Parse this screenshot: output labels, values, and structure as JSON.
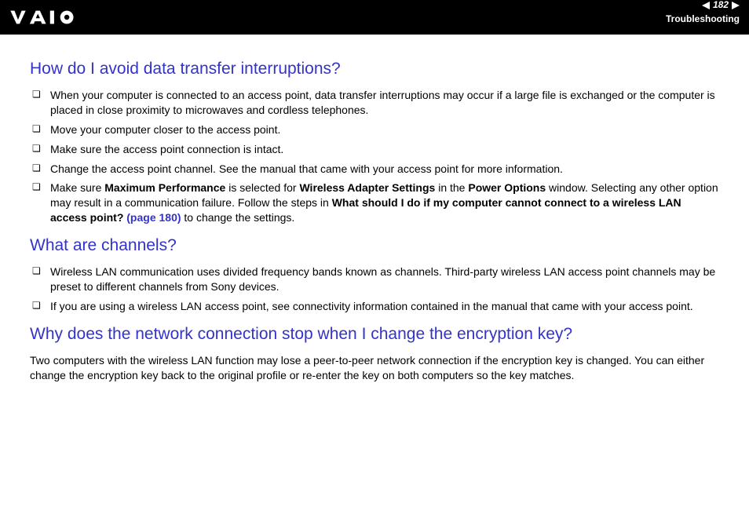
{
  "header": {
    "page_number": "182",
    "section": "Troubleshooting"
  },
  "sections": [
    {
      "heading": "How do I avoid data transfer interruptions?",
      "bullets": [
        {
          "pre": "When your computer is connected to an access point, data transfer interruptions may occur if a large file is exchanged or the computer is placed in close proximity to microwaves and cordless telephones."
        },
        {
          "pre": "Move your computer closer to the access point."
        },
        {
          "pre": "Make sure the access point connection is intact."
        },
        {
          "pre": "Change the access point channel. See the manual that came with your access point for more information."
        },
        {
          "pre": "Make sure ",
          "b1": "Maximum Performance",
          "mid1": " is selected for ",
          "b2": "Wireless Adapter Settings",
          "mid2": " in the ",
          "b3": "Power Options",
          "mid3": " window. Selecting any other option may result in a communication failure. Follow the steps in ",
          "b4": "What should I do if my computer cannot connect to a wireless LAN access point? ",
          "link": "(page 180)",
          "post": " to change the settings."
        }
      ]
    },
    {
      "heading": "What are channels?",
      "bullets": [
        {
          "pre": "Wireless LAN communication uses divided frequency bands known as channels. Third-party wireless LAN access point channels may be preset to different channels from Sony devices."
        },
        {
          "pre": "If you are using a wireless LAN access point, see connectivity information contained in the manual that came with your access point."
        }
      ]
    },
    {
      "heading": "Why does the network connection stop when I change the encryption key?",
      "para": "Two computers with the wireless LAN function may lose a peer-to-peer network connection if the encryption key is changed. You can either change the encryption key back to the original profile or re-enter the key on both computers so the key matches."
    }
  ]
}
